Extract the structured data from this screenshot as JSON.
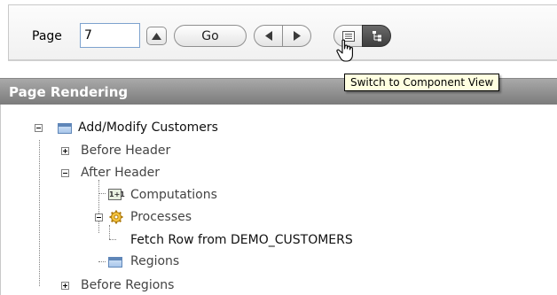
{
  "toolbar": {
    "page_label": "Page",
    "page_value": "7",
    "go_label": "Go"
  },
  "tooltip": "Switch to Component View",
  "region": {
    "title": "Page Rendering"
  },
  "tree": {
    "root": "Add/Modify Customers",
    "before_header": "Before Header",
    "after_header": "After Header",
    "computations": "Computations",
    "computations_icon_text": "1+1",
    "processes": "Processes",
    "fetch_row": "Fetch Row from DEMO_CUSTOMERS",
    "regions": "Regions",
    "before_regions": "Before Regions"
  }
}
